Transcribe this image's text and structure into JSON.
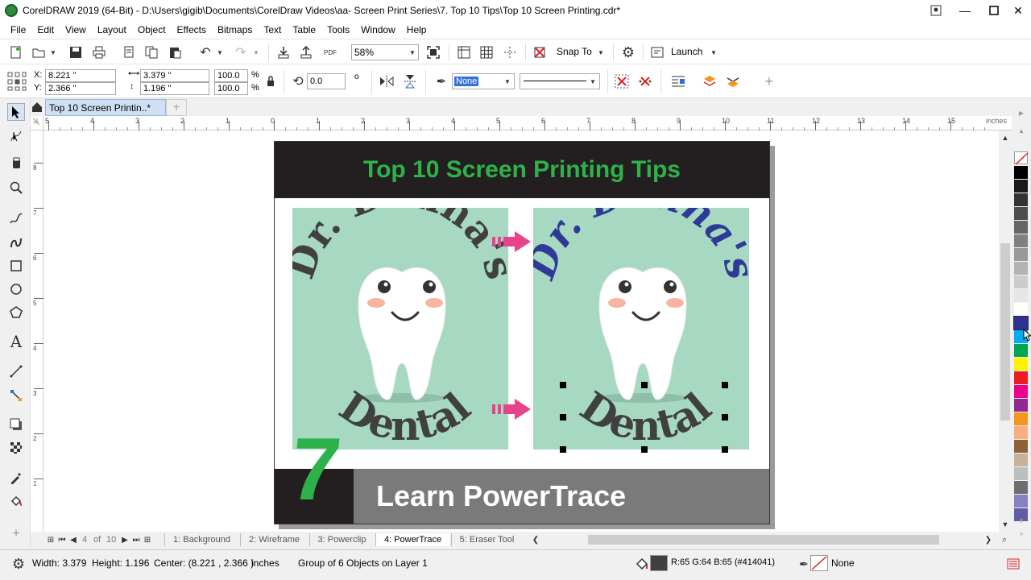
{
  "window": {
    "title": "CorelDRAW 2019 (64-Bit) - D:\\Users\\gigib\\Documents\\CorelDraw Videos\\aa- Screen Print Series\\7. Top 10 Tips\\Top 10 Screen Printing.cdr*"
  },
  "menu": [
    "File",
    "Edit",
    "View",
    "Layout",
    "Object",
    "Effects",
    "Bitmaps",
    "Text",
    "Table",
    "Tools",
    "Window",
    "Help"
  ],
  "toolbar": {
    "zoom": "58%",
    "pdf_label": "PDF",
    "snap_to": "Snap To",
    "launch": "Launch"
  },
  "property_bar": {
    "x_label": "X:",
    "x_value": "8.221 \"",
    "y_label": "Y:",
    "y_value": "2.366 \"",
    "width_value": "3.379 \"",
    "height_value": "1.196 \"",
    "scale_w": "100.0",
    "scale_h": "100.0",
    "pct": "%",
    "rotation": "0.0",
    "outline_width": "None"
  },
  "doc_tab": {
    "label": "Top 10 Screen Printin..*"
  },
  "rulers": {
    "h_ticks": [
      "5",
      "4",
      "3",
      "2",
      "1",
      "0",
      "1",
      "2",
      "3",
      "4",
      "5",
      "6",
      "7",
      "8",
      "9",
      "10",
      "11",
      "12",
      "13",
      "14",
      "15"
    ],
    "v_ticks": [
      "8",
      "7",
      "6",
      "5",
      "4",
      "3",
      "2",
      "1"
    ],
    "units": "inches"
  },
  "slide": {
    "header": "Top 10 Screen Printing Tips",
    "left_logo_top": "Dr. Donna's",
    "left_logo_bottom": "Dental",
    "right_logo_top": "Dr. Donna's",
    "right_logo_bottom": "Dental",
    "number": "7",
    "footer": "Learn PowerTrace"
  },
  "pages": {
    "current": "4",
    "of_label": "of",
    "total": "10",
    "tabs": [
      "1: Background",
      "2: Wireframe",
      "3: Powerclip",
      "4: PowerTrace",
      "5: Eraser Tool"
    ],
    "active_index": 3
  },
  "status": {
    "width_label": "Width: 3.379",
    "height_label": "Height: 1.196",
    "center_label": "Center: (8.221 , 2.366 )",
    "units": "inches",
    "selection": "Group of 6 Objects on Layer 1",
    "fill_color": "R:65 G:64 B:65 (#414041)",
    "outline": "None"
  },
  "colors": {
    "header_bg": "#231f20",
    "title_green": "#2db24a",
    "mint": "#a6d8c2",
    "arrow_pink": "#e8428b",
    "dental_dark": "#414041",
    "dental_blue": "#2f3a96",
    "footer_gray": "#7a7a7a",
    "number_green": "#2db24a",
    "fill_swatch": "#414041"
  },
  "palette": [
    "#ffffff",
    "#000000",
    "#1a1a1a",
    "#333333",
    "#4d4d4d",
    "#666666",
    "#808080",
    "#999999",
    "#b3b3b3",
    "#cccccc",
    "#e6e6e6",
    "#ffffff",
    "#2e3192",
    "#00aeef",
    "#00a651",
    "#fff200",
    "#ed1c24",
    "#ec008c",
    "#92278f",
    "#f7941d",
    "#f9ad81",
    "#8c6239",
    "#c7b299",
    "#bcbec0",
    "#6d6e71",
    "#8781bd",
    "#605ca8"
  ]
}
